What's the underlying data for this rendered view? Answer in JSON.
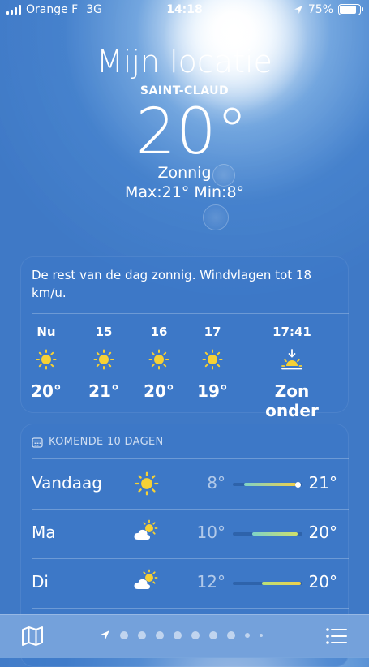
{
  "status_bar": {
    "carrier": "Orange F",
    "network": "3G",
    "time": "14:18",
    "battery": "75%",
    "battery_level": 0.75
  },
  "header": {
    "title": "Mijn locatie",
    "place": "SAINT-CLAUD",
    "temperature": "20°",
    "condition": "Zonnig",
    "max_min": "Max:21°  Min:8°"
  },
  "hourly": {
    "summary": "De rest van de dag zonnig. Windvlagen tot 18 km/u.",
    "items": [
      {
        "label": "Nu",
        "icon": "sun-icon",
        "value": "20°"
      },
      {
        "label": "15",
        "icon": "sun-icon",
        "value": "21°"
      },
      {
        "label": "16",
        "icon": "sun-icon",
        "value": "20°"
      },
      {
        "label": "17",
        "icon": "sun-icon",
        "value": "19°"
      },
      {
        "label": "17:41",
        "icon": "sunset-icon",
        "value": "Zon onder"
      }
    ]
  },
  "forecast": {
    "title": "KOMENDE 10 DAGEN",
    "days": [
      {
        "day": "Vandaag",
        "icon": "sun-icon",
        "low": "8°",
        "high": "21°"
      },
      {
        "day": "Ma",
        "icon": "partly-cloudy-icon",
        "low": "10°",
        "high": "20°"
      },
      {
        "day": "Di",
        "icon": "partly-cloudy-icon",
        "low": "12°",
        "high": "20°"
      }
    ]
  },
  "colors": {
    "sun": "#f6d135",
    "range_cool": "#7fd3c8",
    "range_warm": "#f0d04a"
  }
}
